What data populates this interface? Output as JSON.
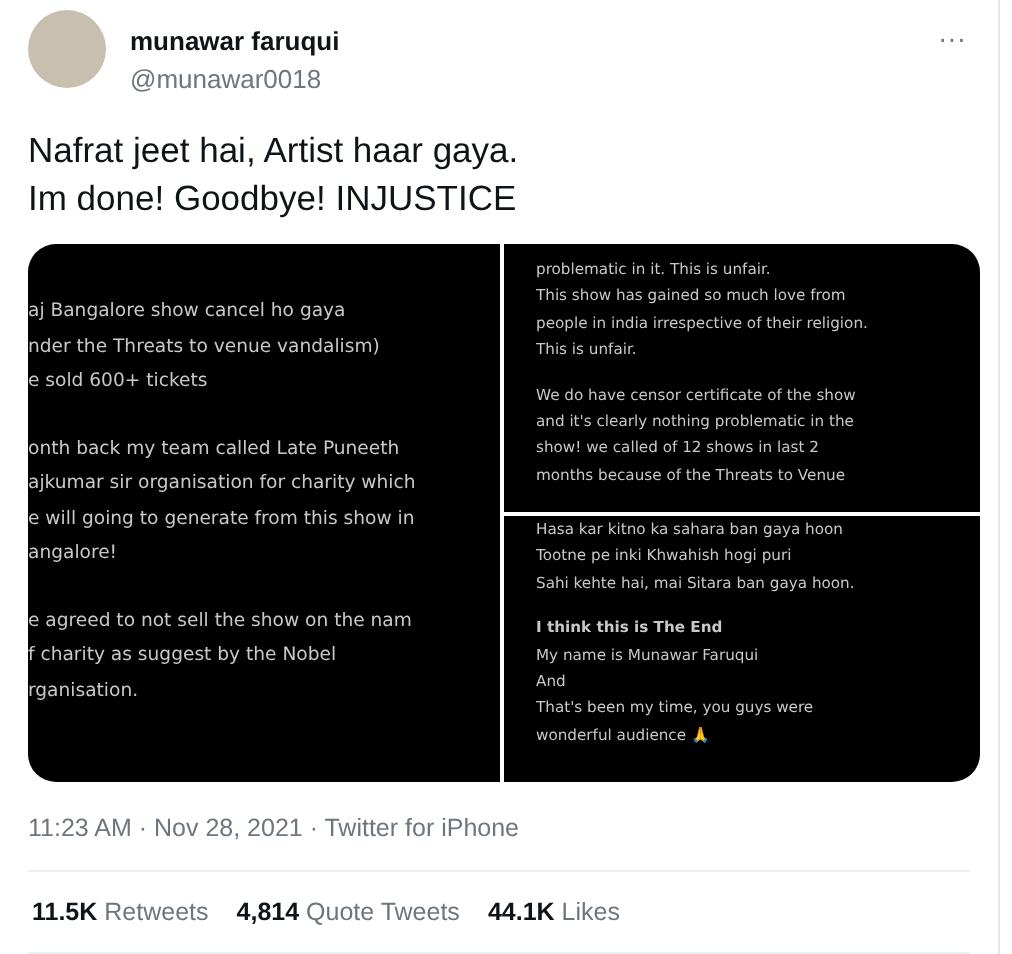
{
  "author": {
    "name": "munawar faruqui",
    "handle": "@munawar0018",
    "more": "···"
  },
  "tweet_text": [
    "Nafrat jeet hai, Artist haar gaya.",
    "Im done! Goodbye! INJUSTICE"
  ],
  "images": [
    {
      "paragraphs": [
        {
          "lines": [
            "aj Bangalore show cancel ho gaya",
            "nder the Threats to venue vandalism)",
            "e sold 600+ tickets"
          ]
        },
        {
          "lines": [
            "onth back my team called Late Puneeth",
            "ajkumar sir organisation for charity which",
            "e will going to generate from this show in",
            "angalore!"
          ]
        },
        {
          "lines": [
            "e agreed to not sell the show on the nam",
            "f charity as suggest by the Nobel",
            "rganisation."
          ]
        }
      ]
    },
    {
      "paragraphs": [
        {
          "lines": [
            "problematic in it. This is unfair.",
            "This show has gained so much love from",
            "people in india irrespective of their religion.",
            "This is unfair."
          ]
        },
        {
          "lines": [
            "We do have censor certificate of the show",
            "and it's clearly nothing problematic in the",
            "show! we called of 12 shows in last 2",
            "months because of the Threats to Venue"
          ]
        }
      ]
    },
    {
      "paragraphs": [
        {
          "lines": [
            "Hasa kar kitno ka sahara ban gaya hoon",
            "Tootne pe inki Khwahish hogi puri",
            "Sahi kehte hai, mai Sitara ban gaya hoon."
          ]
        },
        {
          "heading": "I think this is The End",
          "lines": [
            "My name is Munawar Faruqui",
            "And",
            "That's been my time, you guys were",
            "wonderful audience 🙏"
          ]
        }
      ]
    }
  ],
  "timestamp": "11:23 AM · Nov 28, 2021 · Twitter for iPhone",
  "stats": [
    {
      "count": "11.5K",
      "label": "Retweets"
    },
    {
      "count": "4,814",
      "label": "Quote Tweets"
    },
    {
      "count": "44.1K",
      "label": "Likes"
    }
  ]
}
